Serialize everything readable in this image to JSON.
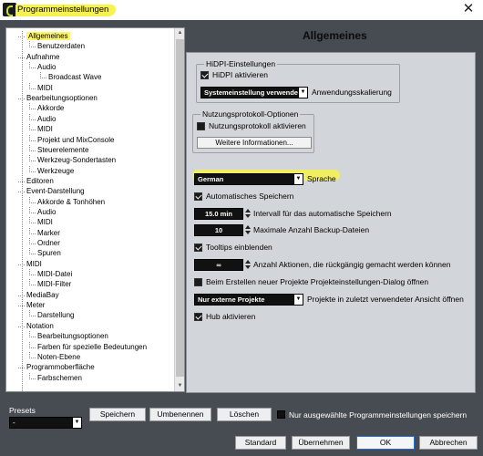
{
  "window": {
    "title": "Programmeinstellungen",
    "close_glyph": "✕"
  },
  "tree": {
    "items": [
      {
        "label": "Allgemeines",
        "level": 0,
        "selected": true
      },
      {
        "label": "Benutzerdaten",
        "level": 1
      },
      {
        "label": "Aufnahme",
        "level": 0
      },
      {
        "label": "Audio",
        "level": 1
      },
      {
        "label": "Broadcast Wave",
        "level": 2
      },
      {
        "label": "MIDI",
        "level": 1
      },
      {
        "label": "Bearbeitungsoptionen",
        "level": 0
      },
      {
        "label": "Akkorde",
        "level": 1
      },
      {
        "label": "Audio",
        "level": 1
      },
      {
        "label": "MIDI",
        "level": 1
      },
      {
        "label": "Projekt und MixConsole",
        "level": 1
      },
      {
        "label": "Steuerelemente",
        "level": 1
      },
      {
        "label": "Werkzeug-Sondertasten",
        "level": 1
      },
      {
        "label": "Werkzeuge",
        "level": 1
      },
      {
        "label": "Editoren",
        "level": 0
      },
      {
        "label": "Event-Darstellung",
        "level": 0
      },
      {
        "label": "Akkorde & Tonhöhen",
        "level": 1
      },
      {
        "label": "Audio",
        "level": 1
      },
      {
        "label": "MIDI",
        "level": 1
      },
      {
        "label": "Marker",
        "level": 1
      },
      {
        "label": "Ordner",
        "level": 1
      },
      {
        "label": "Spuren",
        "level": 1
      },
      {
        "label": "MIDI",
        "level": 0
      },
      {
        "label": "MIDI-Datei",
        "level": 1
      },
      {
        "label": "MIDI-Filter",
        "level": 1
      },
      {
        "label": "MediaBay",
        "level": 0
      },
      {
        "label": "Meter",
        "level": 0
      },
      {
        "label": "Darstellung",
        "level": 1
      },
      {
        "label": "Notation",
        "level": 0
      },
      {
        "label": "Bearbeitungsoptionen",
        "level": 1
      },
      {
        "label": "Farben für spezielle Bedeutungen",
        "level": 1
      },
      {
        "label": "Noten-Ebene",
        "level": 1
      },
      {
        "label": "Programmoberfläche",
        "level": 0
      },
      {
        "label": "Farbschemen",
        "level": 1
      }
    ]
  },
  "main": {
    "heading": "Allgemeines",
    "hidpi": {
      "group_title": "HiDPI-Einstellungen",
      "enable_label": "HiDPI aktivieren",
      "enable_checked": true,
      "scaling_value": "Systemeinstellung verwenden",
      "scaling_label": "Anwendungsskalierung"
    },
    "usage": {
      "group_title": "Nutzungsprotokoll-Optionen",
      "enable_label": "Nutzungsprotokoll aktivieren",
      "enable_checked": false,
      "info_button": "Weitere Informationen..."
    },
    "language": {
      "value": "German",
      "label": "Sprache"
    },
    "autosave": {
      "label": "Automatisches Speichern",
      "checked": true
    },
    "autosave_interval": {
      "value": "15.0 min",
      "label": "Intervall für das automatische Speichern"
    },
    "backups": {
      "value": "10",
      "label": "Maximale Anzahl Backup-Dateien"
    },
    "tooltips": {
      "label": "Tooltips einblenden",
      "checked": true
    },
    "undo": {
      "value": "∞",
      "label": "Anzahl Aktionen, die rückgängig gemacht werden können"
    },
    "project_dialog": {
      "label": "Beim Erstellen neuer Projekte Projekteinstellungen-Dialog öffnen",
      "checked": false
    },
    "project_view": {
      "value": "Nur externe Projekte",
      "label": "Projekte in zuletzt verwendeter Ansicht öffnen"
    },
    "hub": {
      "label": "Hub aktivieren",
      "checked": true
    }
  },
  "presets": {
    "label": "Presets",
    "value": "-",
    "save_button": "Speichern",
    "rename_button": "Umbenennen",
    "delete_button": "Löschen",
    "only_selected_label": "Nur ausgewählte Programmeinstellungen speichern"
  },
  "footer": {
    "standard_button": "Standard",
    "apply_button": "Übernehmen",
    "ok_button": "OK",
    "cancel_button": "Abbrechen"
  },
  "colors": {
    "highlight": "#f8f24e",
    "background": "#474c52",
    "panel": "#d2d5d9"
  }
}
